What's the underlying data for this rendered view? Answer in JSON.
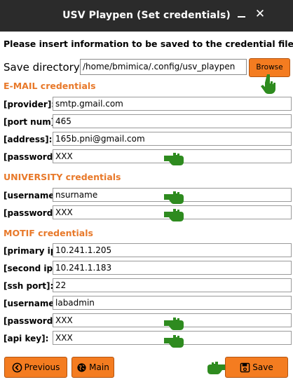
{
  "window": {
    "title": "USV Playpen (Set credentials)",
    "minimize_glyph": "–",
    "close_glyph": "✕"
  },
  "intro_text": "Please insert information to be saved to the credential files",
  "save_directory": {
    "label": "Save directory:",
    "value": "/home/bmimica/.config/usv_playpen",
    "browse_label": "Browse"
  },
  "email": {
    "heading": "E-MAIL credentials",
    "provider_label": "[provider]:",
    "provider_value": "smtp.gmail.com",
    "port_label": "[port num]:",
    "port_value": "465",
    "address_label": "[address]:",
    "address_value": "165b.pni@gmail.com",
    "password_label": "[password]:",
    "password_value": "XXX"
  },
  "university": {
    "heading": "UNIVERSITY credentials",
    "username_label": "[username]:",
    "username_value": "nsurname",
    "password_label": "[password]:",
    "password_value": "XXX"
  },
  "motif": {
    "heading": "MOTIF credentials",
    "primary_ip_label": "[primary ip]:",
    "primary_ip_value": "10.241.1.205",
    "second_ip_label": "[second ip]:",
    "second_ip_value": "10.241.1.183",
    "ssh_port_label": "[ssh port]:",
    "ssh_port_value": "22",
    "username_label": "[username]:",
    "username_value": "labadmin",
    "password_label": "[password]:",
    "password_value": "XXX",
    "api_key_label": "[api key]:",
    "api_key_value": "XXX"
  },
  "footer": {
    "previous_label": "Previous",
    "main_label": "Main",
    "save_label": "Save"
  },
  "colors": {
    "accent": "#f47c20",
    "section_heading": "#e8792a",
    "hand": "#2e8b1f",
    "titlebar": "#2b2b2b"
  },
  "icons": {
    "previous": "circle-arrow-left-icon",
    "main": "globe-icon",
    "save": "floppy-disk-icon",
    "pointer": "pointing-hand-icon"
  }
}
